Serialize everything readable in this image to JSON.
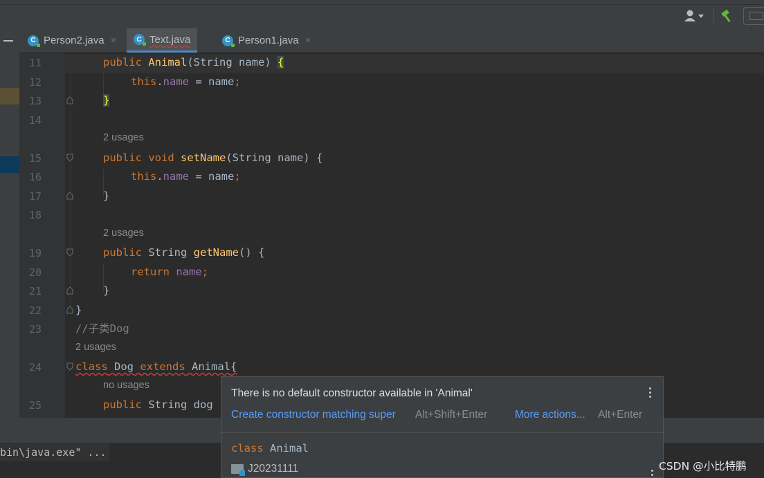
{
  "tabs": [
    {
      "label": "Person2.java",
      "active": false,
      "error": false
    },
    {
      "label": "Text.java",
      "active": true,
      "error": true
    },
    {
      "label": "Person1.java",
      "active": false,
      "error": false
    }
  ],
  "tab_close_glyph": "×",
  "file_icon_letter": "C",
  "line_numbers": [
    "11",
    "12",
    "13",
    "14",
    "15",
    "16",
    "17",
    "18",
    "19",
    "20",
    "21",
    "22",
    "23",
    "24",
    "25"
  ],
  "code": {
    "l11": {
      "kw": "public",
      "fn": "Animal",
      "params": "(String name) ",
      "brace": "{"
    },
    "l12": {
      "kw": "this",
      "dot": ".",
      "fd": "name",
      "rest": " = name",
      "semi": ";"
    },
    "l13": {
      "brace": "}"
    },
    "hint_usages_1": "2 usages",
    "l15": {
      "kw": "public void",
      "fn": "setName",
      "rest": "(String name) {"
    },
    "l16": {
      "kw": "this",
      "dot": ".",
      "fd": "name",
      "rest": " = name",
      "semi": ";"
    },
    "l17": {
      "brace": "}"
    },
    "hint_usages_2": "2 usages",
    "l19": {
      "kw": "public",
      "type": " String ",
      "fn": "getName",
      "rest": "() {"
    },
    "l20": {
      "kw": "return",
      "fd": "name",
      "semi": ";"
    },
    "l21": {
      "brace": "}"
    },
    "l22": {
      "brace": "}"
    },
    "l23": {
      "comment": "//子类Dog"
    },
    "hint_usages_3": "2 usages",
    "l24": {
      "kw1": "class",
      "name": "Dog",
      "kw2": "extends",
      "parent": "Animal",
      "brace": "{"
    },
    "hint_no_usages": "no usages",
    "l25": {
      "kw": "public",
      "rest": " String dog"
    }
  },
  "console": {
    "command": "bin\\java.exe\" ..."
  },
  "popup": {
    "message": "There is no default constructor available in 'Animal'",
    "action_primary": "Create constructor matching super",
    "action_primary_shortcut": "Alt+Shift+Enter",
    "action_more": "More actions...",
    "action_more_shortcut": "Alt+Enter",
    "class_keyword": "class",
    "class_name": "Animal",
    "package": "J20231111"
  },
  "watermark": "CSDN @小比特鹏",
  "colors": {
    "keyword": "#cc7832",
    "function": "#ffc66d",
    "field": "#9876aa",
    "comment": "#808080",
    "link": "#589df6",
    "error_underline": "#bc3f3c",
    "tab_active_underline": "#4a88c7"
  }
}
